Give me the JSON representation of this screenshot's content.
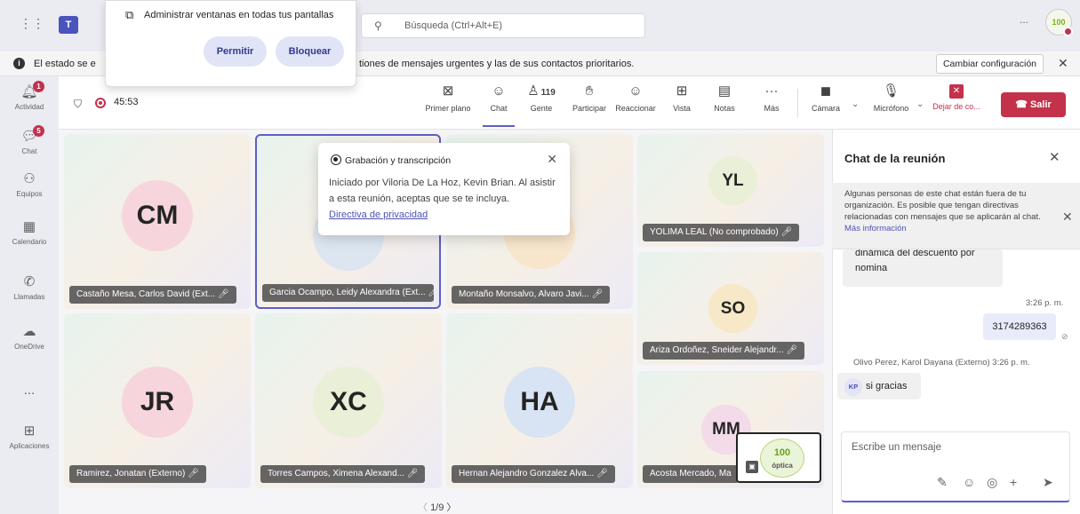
{
  "topbar": {
    "search_placeholder": "Búsqueda (Ctrl+Alt+E)",
    "more_label": "...",
    "avatar_text": "100"
  },
  "popup": {
    "title": "Administrar ventanas en todas tus pantallas",
    "allow_label": "Permitir",
    "block_label": "Bloquear"
  },
  "banner": {
    "text_start": "El estado se e",
    "text_end": "tiones de mensajes urgentes y las de sus contactos prioritarios.",
    "button_label": "Cambiar configuración"
  },
  "rail": {
    "items": [
      {
        "label": "Actividad",
        "badge": "1"
      },
      {
        "label": "Chat",
        "badge": "5"
      },
      {
        "label": "Equipos"
      },
      {
        "label": "Calendario"
      },
      {
        "label": "Llamadas"
      },
      {
        "label": "OneDrive"
      },
      {
        "label": "..."
      },
      {
        "label": "Aplicaciones"
      }
    ]
  },
  "meeting": {
    "timer": "45:53",
    "toolbar": {
      "primer_plano": "Primer plano",
      "chat": "Chat",
      "gente": "Gente",
      "gente_count": "119",
      "participar": "Participar",
      "reaccionar": "Reaccionar",
      "vista": "Vista",
      "notas": "Notas",
      "mas": "Más",
      "camara": "Cámara",
      "microfono": "Micrófono",
      "dejar": "Dejar de co...",
      "salir": "Salir"
    }
  },
  "tiles": [
    {
      "initials": "CM",
      "name": "Castaño Mesa, Carlos David (Ext...",
      "color": "#f6d5dc"
    },
    {
      "initials": "",
      "name": "Garcia Ocampo, Leidy Alexandra (Ext...",
      "color": "#dde6f0"
    },
    {
      "initials": "",
      "name": "Montaño Monsalvo, Alvaro Javi...",
      "color": "#f7e6cc"
    },
    {
      "initials": "YL",
      "name": "YOLIMA LEAL (No comprobado)",
      "color": "#e9f0d7"
    },
    {
      "initials": "SO",
      "name": "Ariza Ordoñez, Sneider Alejandr...",
      "color": "#f7e8c7"
    },
    {
      "initials": "JR",
      "name": "Ramirez, Jonatan (Externo)",
      "color": "#f6d5dc"
    },
    {
      "initials": "XC",
      "name": "Torres Campos, Ximena Alexand...",
      "color": "#e9f0d7"
    },
    {
      "initials": "HA",
      "name": "Hernan Alejandro Gonzalez Alva...",
      "color": "#d8e3f3"
    },
    {
      "initials": "MM",
      "name": "Acosta Mercado, Ma",
      "color": "#f3dbe9"
    }
  ],
  "pager": "1/9",
  "recording_popup": {
    "title": "Grabación y transcripción",
    "body": "Iniciado por Viloria De La Hoz, Kevin Brian. Al asistir a esta reunión, aceptas que se te incluya.",
    "link": "Directiva de privacidad"
  },
  "self_view": {
    "logo_text": "100",
    "logo_sub": "óptica"
  },
  "chat": {
    "title": "Chat de la reunión",
    "notice": "Algunas personas de este chat están fuera de tu organización. Es posible que tengan directivas relacionadas con mensajes que se aplicarán al chat.",
    "notice_link": "Más información",
    "messages": [
      {
        "text_line1": "dinámica del descuento por",
        "text_line2": "nomina"
      },
      {
        "time": "3:26 p. m.",
        "text": "3174289363"
      },
      {
        "sender": "Olivo Perez, Karol Dayana (Externo)  3:26 p. m.",
        "initials": "KP",
        "text": "si gracias"
      }
    ],
    "compose_placeholder": "Escribe un mensaje"
  }
}
